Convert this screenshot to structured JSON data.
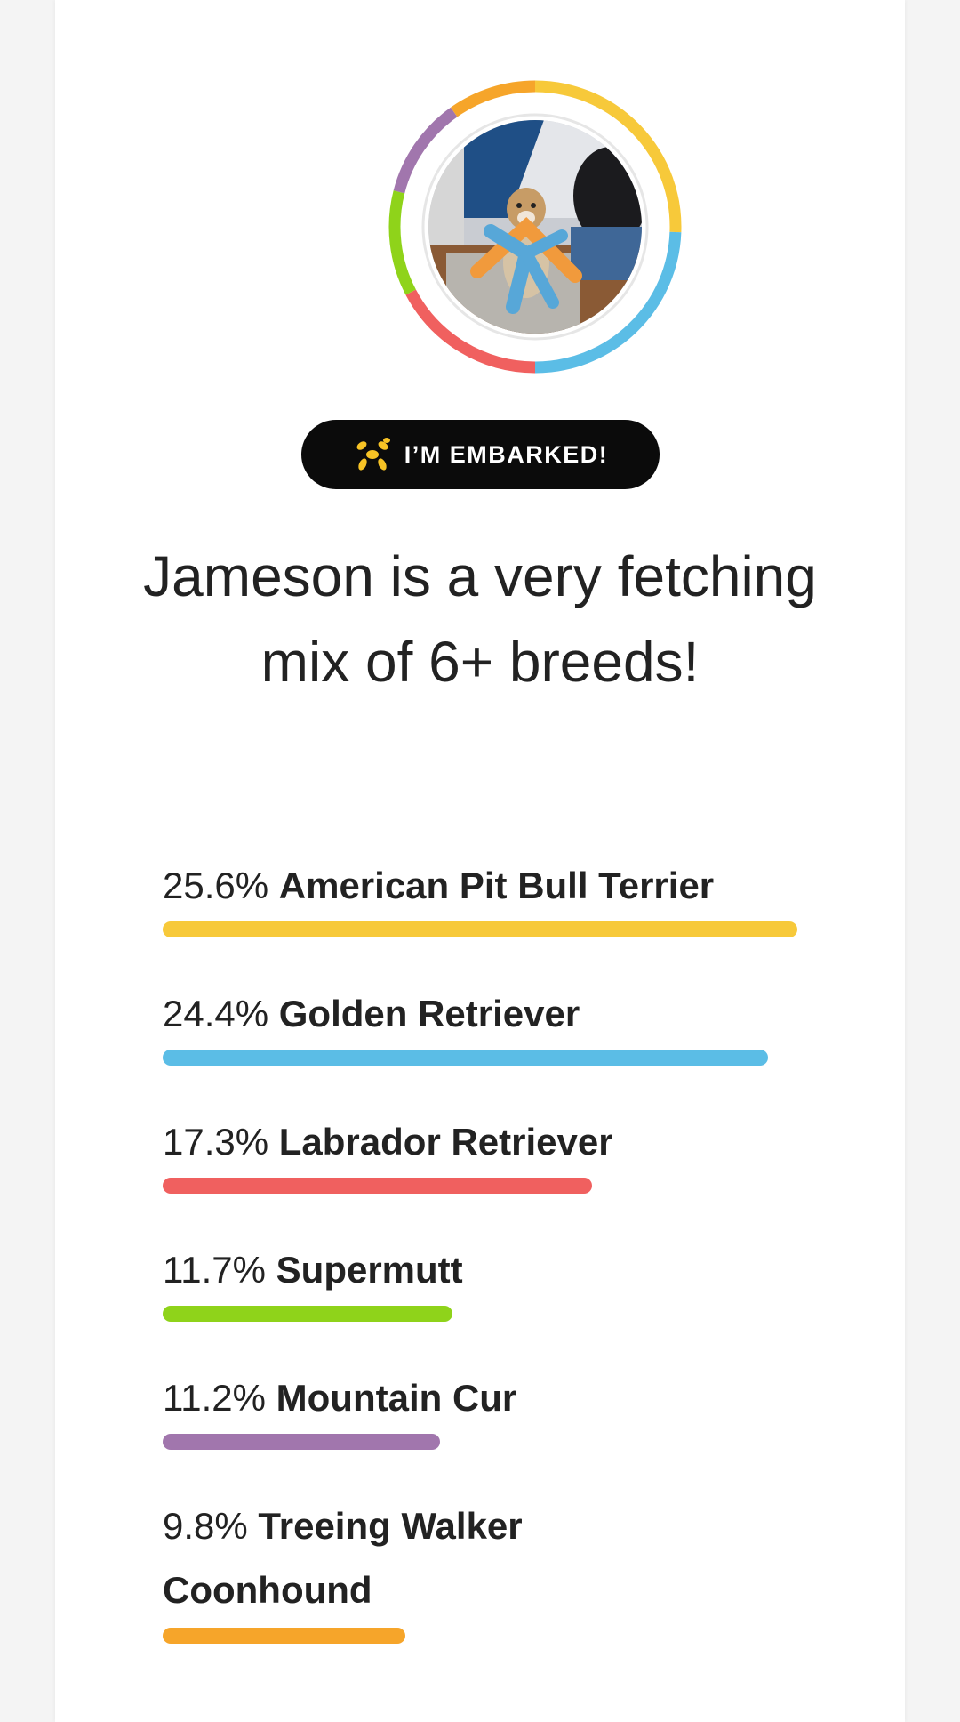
{
  "profile": {
    "dog_name": "Jameson",
    "photo_alt": "dog photo"
  },
  "badge": {
    "label": "I’M EMBARKED!",
    "icon": "balloon-dog-icon",
    "icon_color": "#f7c325"
  },
  "headline": "Jameson is a very fetching mix of 6+ breeds!",
  "breeds": [
    {
      "percent": "25.6%",
      "name": "American Pit Bull Terrier",
      "value": 25.6,
      "color": "#f7c93a"
    },
    {
      "percent": "24.4%",
      "name": "Golden Retriever",
      "value": 24.4,
      "color": "#5bbde6"
    },
    {
      "percent": "17.3%",
      "name": "Labrador Retriever",
      "value": 17.3,
      "color": "#f0605f"
    },
    {
      "percent": "11.7%",
      "name": "Supermutt",
      "value": 11.7,
      "color": "#8fd31a"
    },
    {
      "percent": "11.2%",
      "name": "Mountain Cur",
      "value": 11.2,
      "color": "#a176ad"
    },
    {
      "percent": "9.8%",
      "name": "Treeing Walker Coonhound",
      "value": 9.8,
      "color": "#f6a52a"
    }
  ]
}
